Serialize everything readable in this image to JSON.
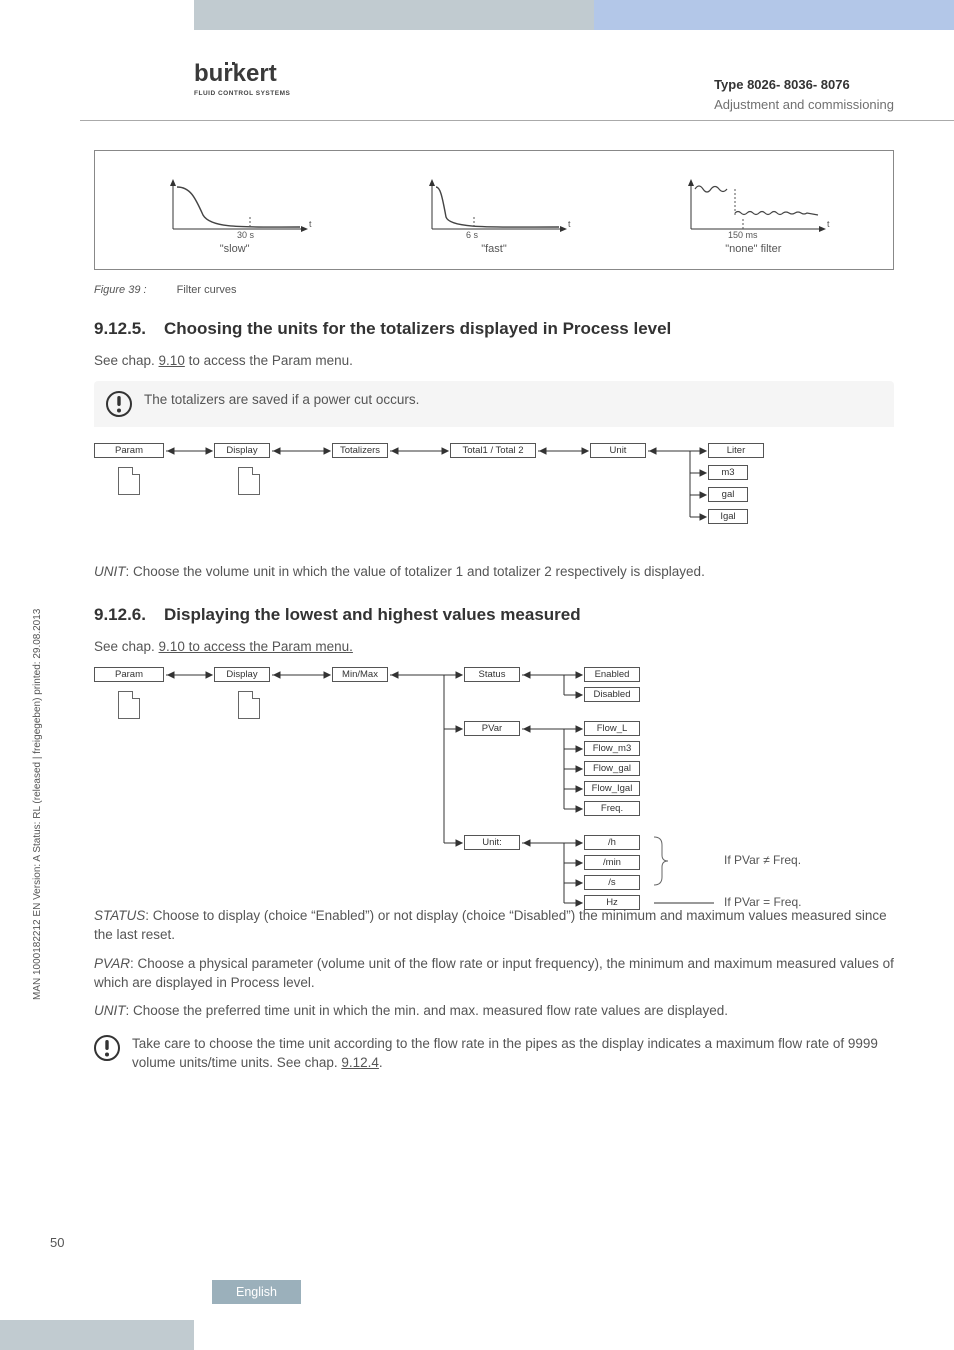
{
  "header": {
    "logo_sub": "FLUID CONTROL SYSTEMS",
    "type_line": "Type 8026- 8036- 8076",
    "subtitle": "Adjustment and commissioning"
  },
  "side_text": "MAN 1000182212 EN Version: A Status: RL (released | freigegeben) printed: 29.08.2013",
  "figure": {
    "curves": [
      {
        "time": "30 s",
        "t": "t",
        "label": "\"slow\""
      },
      {
        "time": "6 s",
        "t": "t",
        "label": "\"fast\""
      },
      {
        "time": "150 ms",
        "t": "t",
        "label": "\"none\" filter"
      }
    ],
    "caption_num": "Figure 39 :",
    "caption_text": "Filter curves"
  },
  "sec5": {
    "num": "9.12.5.",
    "title": "Choosing the units for the totalizers displayed in Process level",
    "see": "See chap. ",
    "see_link": "9.10",
    "see_rest": " to access the Param menu.",
    "notice": "The totalizers are saved if a power cut occurs.",
    "flow": {
      "n0": "Param",
      "n1": "Display",
      "n2": "Totalizers",
      "n3": "Total1 / Total 2",
      "n4": "Unit",
      "opts": [
        "Liter",
        "m3",
        "gal",
        "Igal"
      ]
    },
    "unit_ital": "UNIT",
    "unit_text": ": Choose the volume unit in which the value of totalizer 1 and totalizer 2 respectively is displayed."
  },
  "sec6": {
    "num": "9.12.6.",
    "title": "Displaying the lowest and highest values measured",
    "see": "See chap. ",
    "see_link": "9.10 to access the Param menu.",
    "flow": {
      "n0": "Param",
      "n1": "Display",
      "n2": "Min/Max",
      "g1": "Status",
      "g1o": [
        "Enabled",
        "Disabled"
      ],
      "g2": "PVar",
      "g2o": [
        "Flow_L",
        "Flow_m3",
        "Flow_gal",
        "Flow_Igal",
        "Freq."
      ],
      "g3": "Unit:",
      "g3o": [
        "/h",
        "/min",
        "/s",
        "Hz"
      ]
    },
    "bracket1": "If PVar ≠ Freq.",
    "bracket2": "If PVar = Freq.",
    "status_ital": "STATUS",
    "status_text": ": Choose to display (choice “Enabled”) or not display (choice “Disabled”) the minimum and maximum values measured since the last reset.",
    "pvar_ital": "PVAR",
    "pvar_text": ": Choose a physical parameter (volume unit of the flow rate or input frequency), the minimum and maximum measured values of which are displayed in Process level.",
    "unit_ital": "UNIT",
    "unit_text": ": Choose the preferred time unit in which the min. and max. measured flow rate values are displayed.",
    "notice": "Take care to choose the time unit according to the flow rate in the pipes as the display indicates a maximum flow rate of 9999 volume units/time units. See chap. ",
    "notice_link": "9.12.4",
    "notice_dot": "."
  },
  "footer": {
    "page": "50",
    "lang": "English"
  }
}
